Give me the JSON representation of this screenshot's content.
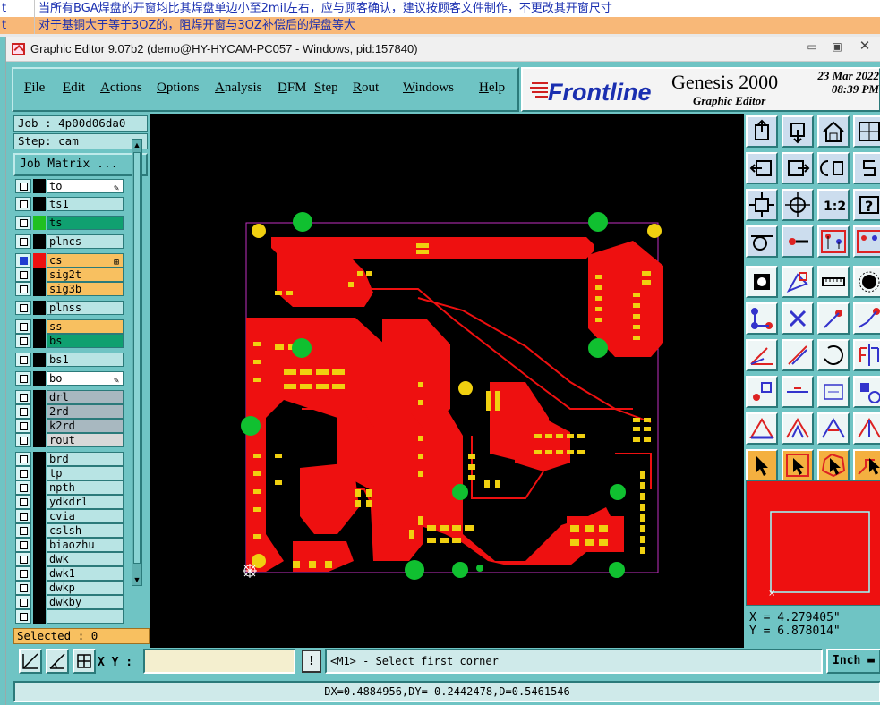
{
  "background_rows": [
    {
      "col1": "t",
      "col2": "当所有BGA焊盘的开窗均比其焊盘单边小至2mil左右，应与顾客确认，建议按顾客文件制作，不更改其开窗尺寸"
    },
    {
      "col1": "t",
      "col2": "对于基铜大于等于3OZ的，阻焊开窗与3OZ补偿后的焊盘等大"
    }
  ],
  "window": {
    "title": "Graphic Editor 9.07b2 (demo@HY-HYCAM-PC057 - Windows, pid:157840)",
    "controls": [
      "minimize-icon",
      "restore-icon",
      "close-icon"
    ]
  },
  "menu": {
    "items": [
      {
        "label": "File",
        "hot": "F",
        "rest": "ile"
      },
      {
        "label": "Edit",
        "hot": "E",
        "rest": "dit"
      },
      {
        "label": "Actions",
        "hot": "A",
        "rest": "ctions"
      },
      {
        "label": "Options",
        "hot": "O",
        "rest": "ptions"
      },
      {
        "label": "Analysis",
        "hot": "A",
        "rest": "nalysis"
      },
      {
        "label": "DFM",
        "hot": "D",
        "rest": "FM"
      },
      {
        "label": "Step",
        "hot": "S",
        "rest": "tep"
      },
      {
        "label": "Rout",
        "hot": "R",
        "rest": "out"
      },
      {
        "label": "Windows",
        "hot": "W",
        "rest": "indows"
      },
      {
        "label": "Help",
        "hot": "H",
        "rest": "elp"
      }
    ]
  },
  "brand": {
    "logo": "Frontline",
    "product": "Genesis 2000",
    "date_line1": "23 Mar 2022",
    "date_line2": "08:39 PM",
    "subtitle": "Graphic Editor"
  },
  "job": {
    "job_label": "Job : 4p00d06da0",
    "step_label": "Step: cam",
    "matrix_button": "Job Matrix ..."
  },
  "layers": [
    {
      "name": "to",
      "color": "#ffffff",
      "swatch": "#000000",
      "check": "white",
      "edit": true
    },
    {
      "name": "ts1",
      "color": "#b8e4e4",
      "swatch": "#000000",
      "check": "white"
    },
    {
      "name": "ts",
      "color": "#10a070",
      "swatch": "#20c020",
      "check": "white"
    },
    {
      "name": "plncs",
      "color": "#b8e4e4",
      "swatch": "#000000",
      "check": "white"
    },
    {
      "name": "cs",
      "color": "#f8c060",
      "swatch": "#ee1010",
      "check": "blue",
      "mark": "⊞"
    },
    {
      "name": "sig2t",
      "color": "#f8c060",
      "swatch": "#000000",
      "check": "white"
    },
    {
      "name": "sig3b",
      "color": "#f8c060",
      "swatch": "#000000",
      "check": "white"
    },
    {
      "name": "plnss",
      "color": "#b8e4e4",
      "swatch": "#000000",
      "check": "white"
    },
    {
      "name": "ss",
      "color": "#f8c060",
      "swatch": "#000000",
      "check": "white"
    },
    {
      "name": "bs",
      "color": "#10a070",
      "swatch": "#000000",
      "check": "white"
    },
    {
      "name": "bs1",
      "color": "#b8e4e4",
      "swatch": "#000000",
      "check": "white"
    },
    {
      "name": "bo",
      "color": "#ffffff",
      "swatch": "#000000",
      "check": "white",
      "edit": true
    },
    {
      "name": "drl",
      "color": "#a8b8c0",
      "swatch": "#000000",
      "check": "white"
    },
    {
      "name": "2rd",
      "color": "#a8b8c0",
      "swatch": "#000000",
      "check": "white"
    },
    {
      "name": "k2rd",
      "color": "#a8b8c0",
      "swatch": "#000000",
      "check": "white"
    },
    {
      "name": "rout",
      "color": "#d8d8d8",
      "swatch": "#000000",
      "check": "white"
    },
    {
      "name": "brd",
      "color": "#b8e4e4",
      "swatch": "#000000",
      "check": "white"
    },
    {
      "name": "tp",
      "color": "#b8e4e4",
      "swatch": "#000000",
      "check": "white"
    },
    {
      "name": "npth",
      "color": "#b8e4e4",
      "swatch": "#000000",
      "check": "white"
    },
    {
      "name": "ydkdrl",
      "color": "#b8e4e4",
      "swatch": "#000000",
      "check": "white"
    },
    {
      "name": "cvia",
      "color": "#b8e4e4",
      "swatch": "#000000",
      "check": "white"
    },
    {
      "name": "cslsh",
      "color": "#b8e4e4",
      "swatch": "#000000",
      "check": "white"
    },
    {
      "name": "biaozhu",
      "color": "#b8e4e4",
      "swatch": "#000000",
      "check": "white"
    },
    {
      "name": "dwk",
      "color": "#b8e4e4",
      "swatch": "#000000",
      "check": "white"
    },
    {
      "name": "dwk1",
      "color": "#b8e4e4",
      "swatch": "#000000",
      "check": "white"
    },
    {
      "name": "dwkp",
      "color": "#b8e4e4",
      "swatch": "#000000",
      "check": "white"
    },
    {
      "name": "dwkby",
      "color": "#b8e4e4",
      "swatch": "#000000",
      "check": "white"
    },
    {
      "name": "",
      "color": "#b8e4e4",
      "swatch": "#000000",
      "check": "white"
    }
  ],
  "selected": "Selected : 0",
  "coords": {
    "x": "X =  4.279405\"",
    "y": "Y =  6.878014\""
  },
  "tools": [
    "step-up-icon",
    "step-down-icon",
    "home-icon",
    "window-icon",
    "pan-left-icon",
    "pan-right-icon",
    "redraw-icon",
    "split-icon",
    "zoom-fit-icon",
    "zoom-center-icon",
    "zoom-1to2-icon",
    "help-query-icon",
    "measure-icon",
    "probe-icon",
    "layer-compare-icon",
    "layer-compare2-icon",
    "pad-add-icon",
    "line-add-icon",
    "ruler-icon",
    "circle-add-icon",
    "net-select-icon",
    "delete-icon",
    "move-point-icon",
    "extend-icon",
    "angle-icon",
    "line-draw-icon",
    "arc-icon",
    "mirror-icon",
    "snap-icon",
    "align-icon",
    "dimension-icon",
    "rotate-icon",
    "triangle-icon",
    "triangle2-icon",
    "triangle3-icon",
    "triangle4-icon",
    "pointer-icon",
    "select-box-icon",
    "select-poly-icon",
    "select-path-icon"
  ],
  "bottom": {
    "xy_label": "X Y :",
    "xy_value": "",
    "prompt": "<M1> - Select first corner",
    "unit": "Inch",
    "status": "DX=0.4884956,DY=-0.2442478,D=0.5461546"
  }
}
